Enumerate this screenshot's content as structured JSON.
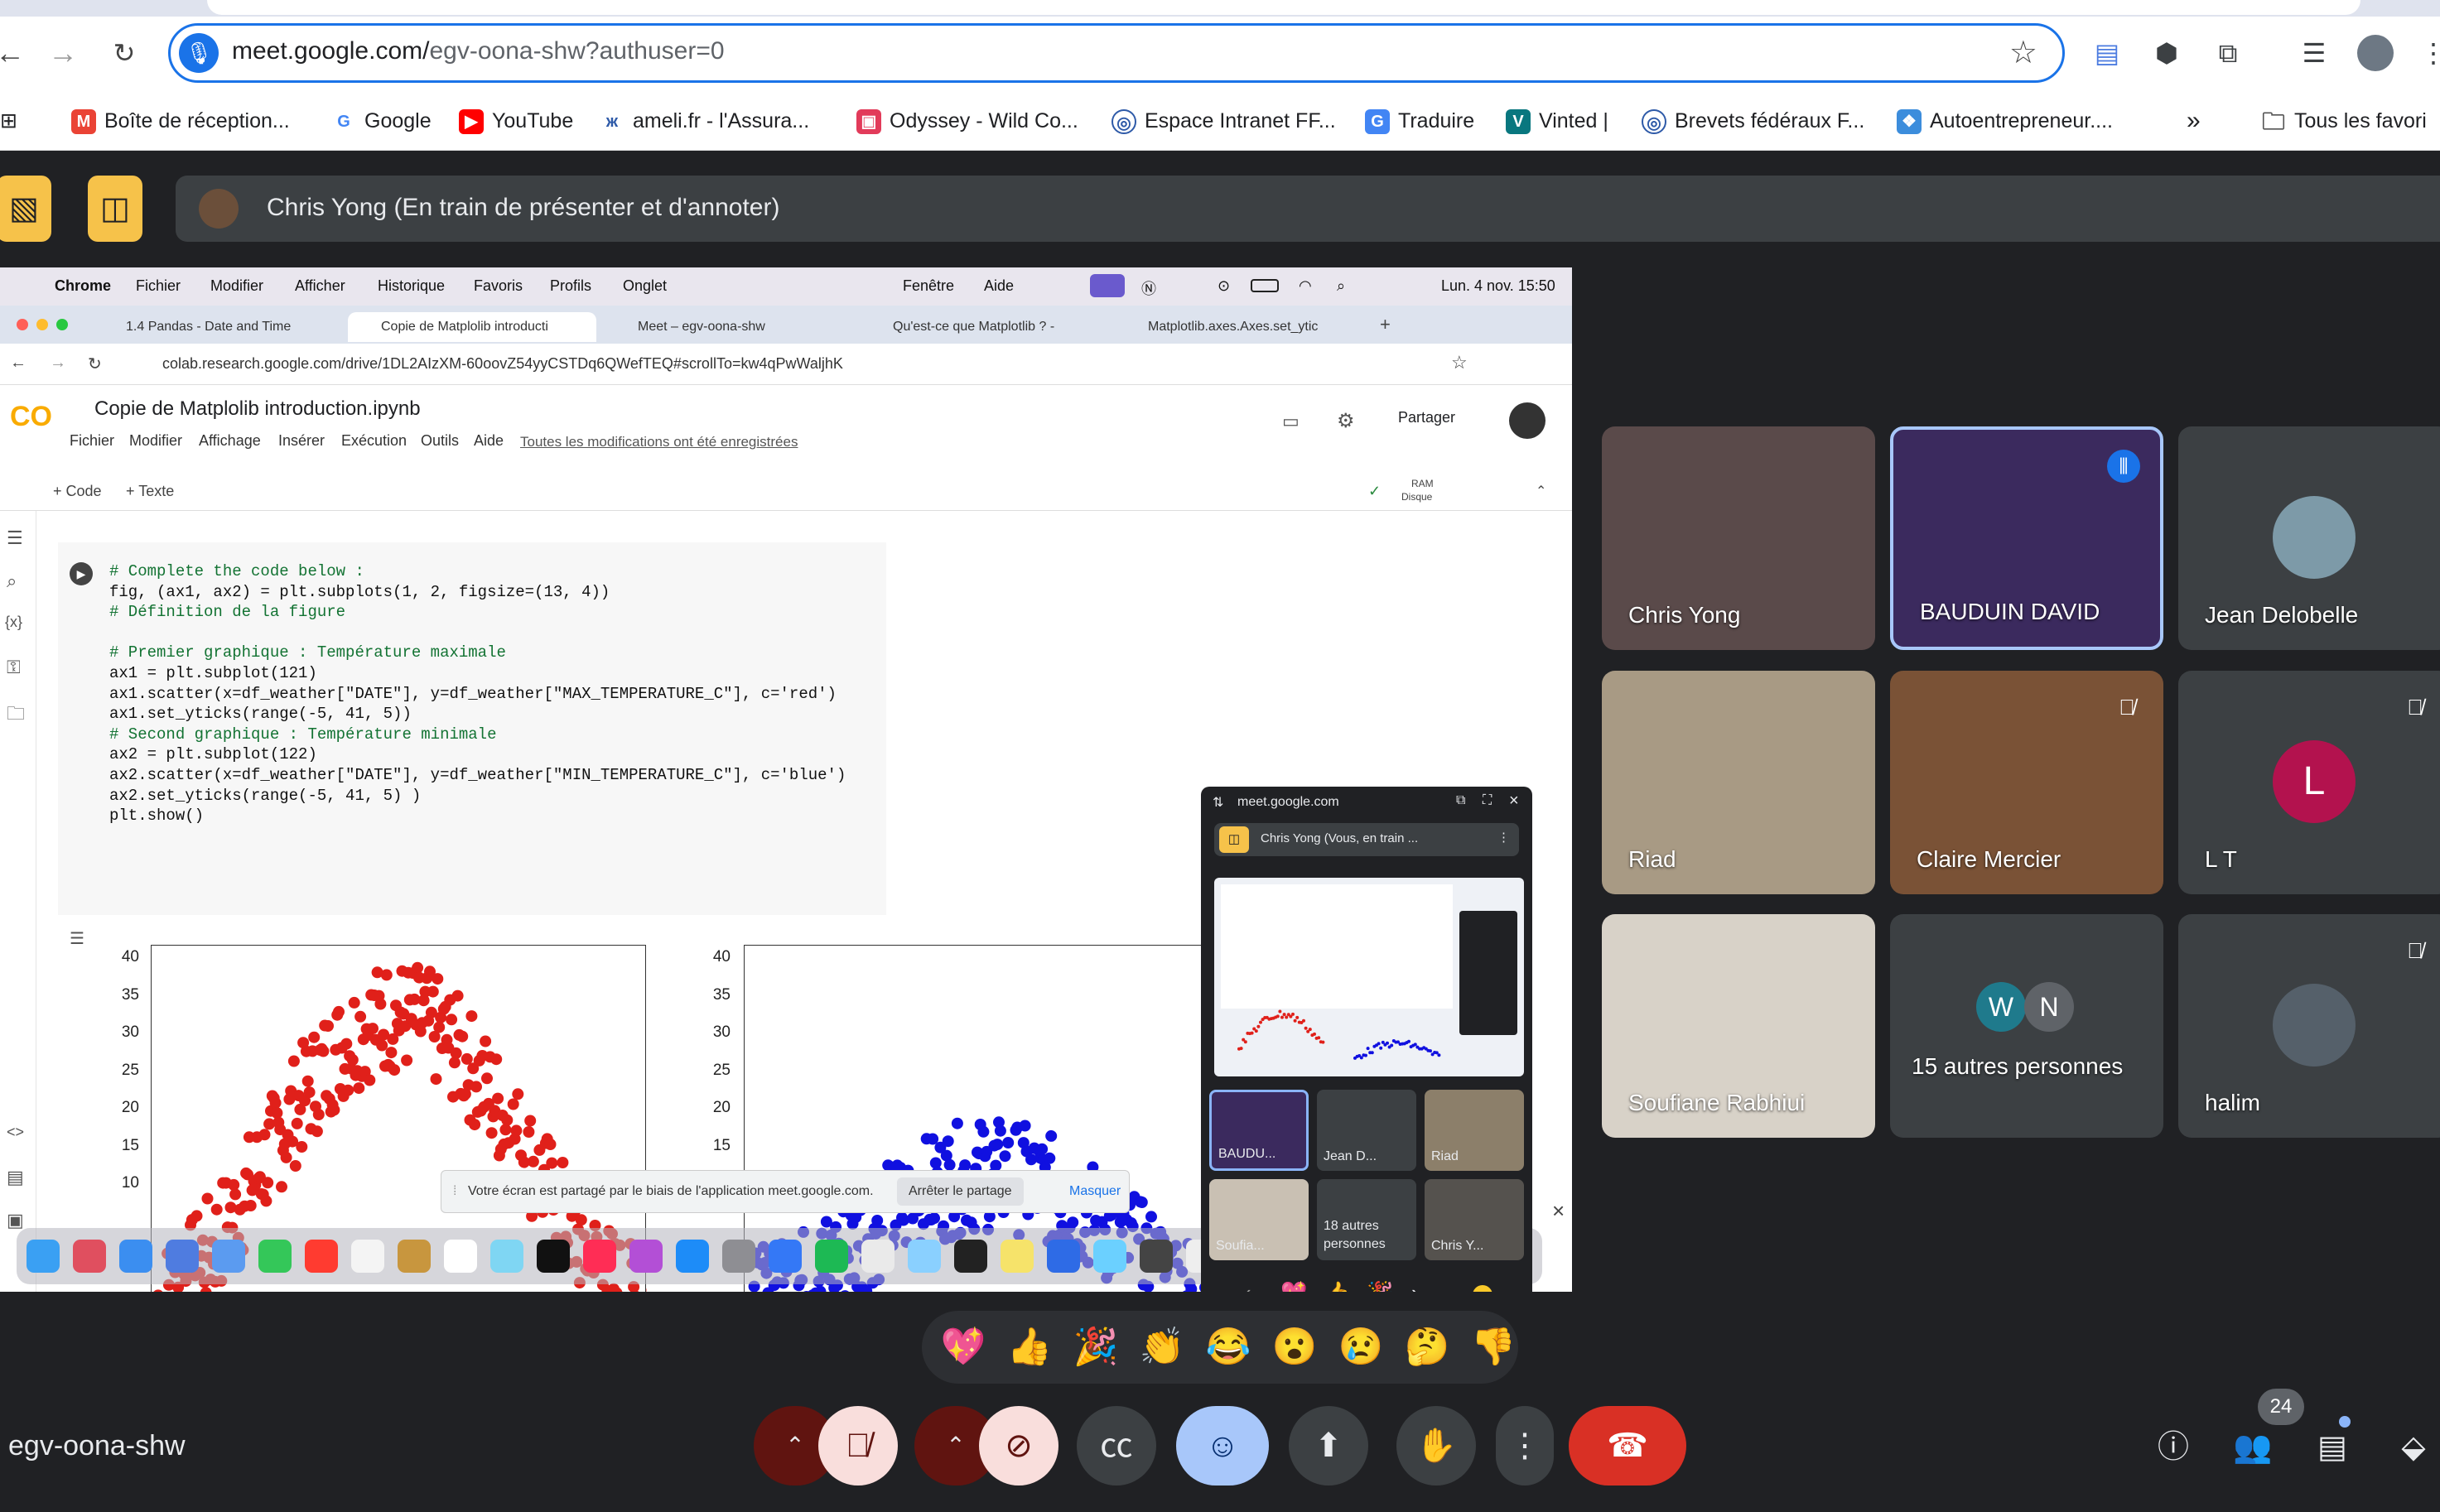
{
  "browser": {
    "url_host": "meet.google.com/",
    "url_path": "egv-oona-shw?authuser=0",
    "bookmarks": [
      "Boîte de réception...",
      "Google",
      "YouTube",
      "ameli.fr - l'Assura...",
      "Odyssey - Wild Co...",
      "Espace Intranet FF...",
      "Traduire",
      "Vinted |",
      "Brevets fédéraux F...",
      "Autoentrepreneur....",
      "Tous les favori"
    ]
  },
  "meet": {
    "presenter_banner": "Chris Yong (En train de présenter et d'annoter)",
    "meeting_code": "egv-oona-shw",
    "participant_count": "24",
    "reactions": [
      "💖",
      "👍",
      "🎉",
      "👏",
      "😂",
      "😮",
      "😢",
      "🤔",
      "👎"
    ],
    "tiles": [
      {
        "name": "Chris Yong",
        "bg": "#5a4a4a",
        "muted": false
      },
      {
        "name": "BAUDUIN DAVID",
        "bg": "#3b2a5e",
        "muted": false
      },
      {
        "name": "Jean Delobelle",
        "bg": "#3c4043",
        "muted": false
      },
      {
        "name": "Riad",
        "bg": "#a89a84",
        "muted": false
      },
      {
        "name": "Claire Mercier",
        "bg": "#7a5236",
        "muted": true
      },
      {
        "name": "L T",
        "bg": "#3c4043",
        "muted": true,
        "initial": "L"
      },
      {
        "name": "Soufiane Rabhiui",
        "bg": "#d8d2c8",
        "muted": false
      },
      {
        "name": "15 autres personnes",
        "bg": "#3c4043",
        "muted": false
      },
      {
        "name": "halim",
        "bg": "#3c4043",
        "muted": true
      }
    ],
    "others_initials": [
      "W",
      "N"
    ]
  },
  "screen": {
    "mac_menu": [
      "Chrome",
      "Fichier",
      "Modifier",
      "Afficher",
      "Historique",
      "Favoris",
      "Profils",
      "Onglet",
      "Fenêtre",
      "Aide"
    ],
    "clock": "Lun. 4 nov. 15:50",
    "tabs": [
      "1.4 Pandas - Date and Time",
      "Copie de Matplolib introducti",
      "Meet – egv-oona-shw",
      "Qu'est-ce que Matplotlib ? -",
      "Matplotlib.axes.Axes.set_ytic"
    ],
    "colab_url": "colab.research.google.com/drive/1DL2AIzXM-60oovZ54yyCSTDq6QWefTEQ#scrollTo=kw4qPwWaljhK",
    "notebook_title": "Copie de Matplolib introduction.ipynb",
    "colab_menu": [
      "Fichier",
      "Modifier",
      "Affichage",
      "Insérer",
      "Exécution",
      "Outils",
      "Aide"
    ],
    "saved_msg": "Toutes les modifications ont été enregistrées",
    "share_label": "Partager",
    "add_code": "+ Code",
    "add_text": "+ Texte",
    "ram_label": "RAM",
    "disk_label": "Disque",
    "share_notice": "Votre écran est partagé par le biais de l'application meet.google.com.",
    "stop_share": "Arrêter le partage",
    "hide": "Masquer",
    "code_lines": [
      {
        "t": "# Complete the code below :",
        "k": "c"
      },
      {
        "t": "fig, (ax1, ax2) = plt.subplots(1, 2, figsize=(13, 4))",
        "k": ""
      },
      {
        "t": "# Définition de la figure",
        "k": "c"
      },
      {
        "t": "",
        "k": ""
      },
      {
        "t": "# Premier graphique : Température maximale",
        "k": "c"
      },
      {
        "t": "ax1 = plt.subplot(121)",
        "k": ""
      },
      {
        "t": "ax1.scatter(x=df_weather[\"DATE\"], y=df_weather[\"MAX_TEMPERATURE_C\"], c='red')",
        "k": ""
      },
      {
        "t": "ax1.set_yticks(range(-5, 41, 5))",
        "k": ""
      },
      {
        "t": "# Second graphique : Température minimale",
        "k": "c"
      },
      {
        "t": "ax2 = plt.subplot(122)",
        "k": ""
      },
      {
        "t": "ax2.scatter(x=df_weather[\"DATE\"], y=df_weather[\"MIN_TEMPERATURE_C\"], c='blue')",
        "k": ""
      },
      {
        "t": "ax2.set_yticks(range(-5, 41, 5) )",
        "k": ""
      },
      {
        "t": "plt.show()",
        "k": ""
      }
    ],
    "yticks": [
      "40",
      "35",
      "30",
      "25",
      "20",
      "15",
      "10"
    ]
  },
  "pip": {
    "host": "meet.google.com",
    "banner": "Chris Yong (Vous, en train ...",
    "tiles": [
      "BAUDU...",
      "Jean D...",
      "Riad",
      "Soufia...",
      "18 autres personnes",
      "Chris Y..."
    ]
  },
  "chart_data": [
    {
      "type": "scatter",
      "color": "#e0201a",
      "ylim": [
        8,
        41
      ],
      "yticks": [
        10,
        15,
        20,
        25,
        30,
        35,
        40
      ],
      "series": [
        {
          "name": "MAX_TEMPERATURE_C",
          "shape": "seasonal",
          "peak": 39,
          "trough": 9
        }
      ]
    },
    {
      "type": "scatter",
      "color": "#1010e0",
      "ylim": [
        8,
        41
      ],
      "yticks": [
        10,
        15,
        20,
        25,
        30,
        35,
        40
      ],
      "series": [
        {
          "name": "MIN_TEMPERATURE_C",
          "shape": "seasonal",
          "peak": 25,
          "trough": 9
        }
      ]
    }
  ]
}
